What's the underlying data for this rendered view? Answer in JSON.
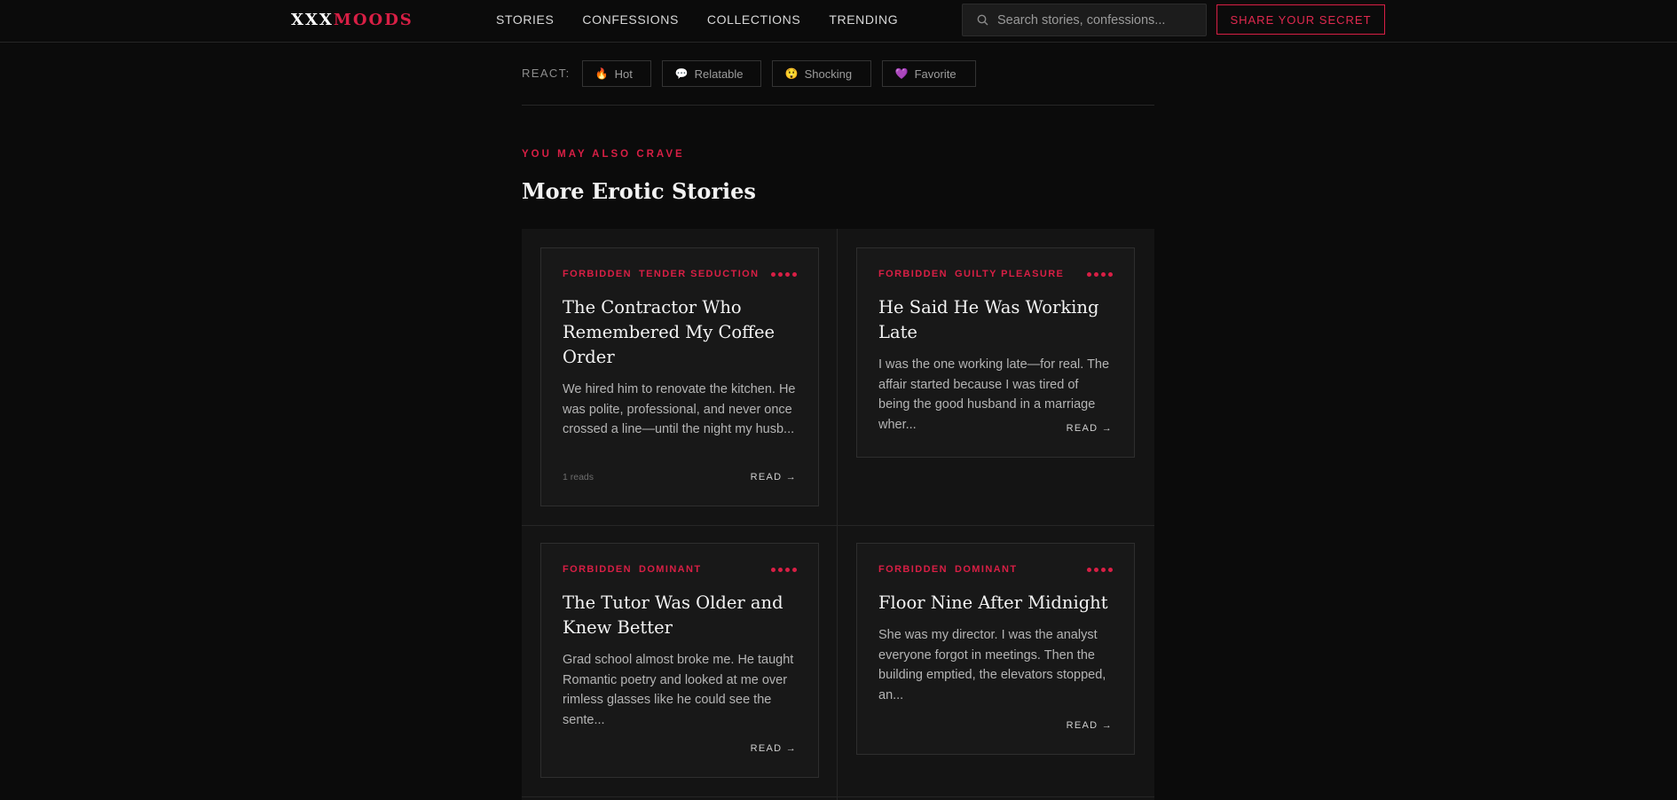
{
  "header": {
    "logo_part1": "XXX",
    "logo_part2": "MOODS",
    "nav": [
      "STORIES",
      "CONFESSIONS",
      "COLLECTIONS",
      "TRENDING"
    ],
    "search_placeholder": "Search stories, confessions...",
    "share_button": "SHARE YOUR SECRET"
  },
  "reactions": {
    "label": "REACT:",
    "buttons": [
      {
        "icon": "fire-icon",
        "glyph": "🔥",
        "label": "Hot"
      },
      {
        "icon": "speech-bubble-icon",
        "glyph": "💬",
        "label": "Relatable"
      },
      {
        "icon": "shocked-face-icon",
        "glyph": "😲",
        "label": "Shocking"
      },
      {
        "icon": "heart-icon",
        "glyph": "💜",
        "label": "Favorite"
      }
    ]
  },
  "related": {
    "eyebrow": "YOU MAY ALSO CRAVE",
    "title": "More Erotic Stories",
    "cards": [
      {
        "tags": [
          "FORBIDDEN",
          "TENDER SEDUCTION"
        ],
        "title": "The Contractor Who Remembered My Coffee Order",
        "excerpt": "We hired him to renovate the kitchen. He was polite, professional, and never once crossed a line—until the night my husb...",
        "reads": "1 reads",
        "read_label": "READ →"
      },
      {
        "tags": [
          "FORBIDDEN",
          "GUILTY PLEASURE"
        ],
        "title": "He Said He Was Working Late",
        "excerpt": "I was the one working late—for real. The affair started because I was tired of being the good husband in a marriage wher...",
        "reads": "",
        "read_label": "READ →"
      },
      {
        "tags": [
          "FORBIDDEN",
          "DOMINANT"
        ],
        "title": "The Tutor Was Older and Knew Better",
        "excerpt": "Grad school almost broke me. He taught Romantic poetry and looked at me over rimless glasses like he could see the sente...",
        "reads": "",
        "read_label": "READ →"
      },
      {
        "tags": [
          "FORBIDDEN",
          "DOMINANT"
        ],
        "title": "Floor Nine After Midnight",
        "excerpt": "She was my director. I was the analyst everyone forgot in meetings. Then the building emptied, the elevators stopped, an...",
        "reads": "",
        "read_label": "READ →"
      }
    ]
  },
  "colors": {
    "accent": "#d81f45",
    "background": "#0b0b0b",
    "card": "#181818"
  }
}
